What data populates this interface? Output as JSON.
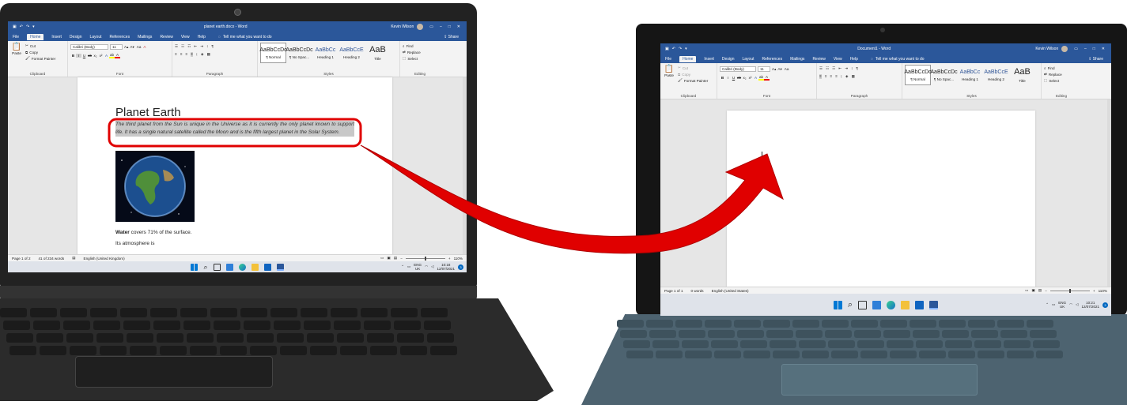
{
  "left_window": {
    "title": "planet earth.docx - Word",
    "user": "Kevin Wilson",
    "tabs": [
      "File",
      "Home",
      "Insert",
      "Design",
      "Layout",
      "References",
      "Mailings",
      "Review",
      "View",
      "Help"
    ],
    "tell_me": "Tell me what you want to do",
    "share": "Share",
    "clipboard": {
      "paste": "Paste",
      "cut": "Cut",
      "copy": "Copy",
      "format_painter": "Format Painter",
      "label": "Clipboard"
    },
    "font": {
      "name": "Calibri (Body)",
      "size": "11",
      "label": "Font"
    },
    "paragraph_label": "Paragraph",
    "styles": [
      {
        "preview": "AaBbCcDc",
        "name": "¶ Normal"
      },
      {
        "preview": "AaBbCcDc",
        "name": "¶ No Spac..."
      },
      {
        "preview": "AaBbCc",
        "name": "Heading 1"
      },
      {
        "preview": "AaBbCcE",
        "name": "Heading 2"
      },
      {
        "preview": "AaB",
        "name": "Title"
      }
    ],
    "styles_label": "Styles",
    "editing": {
      "find": "Find",
      "replace": "Replace",
      "select": "Select",
      "label": "Editing"
    },
    "document": {
      "heading": "Planet Earth",
      "paragraph": "The third planet from the Sun is unique in the Universe as it is currently the only planet known to support life. It has a single natural satellite called the Moon and is the fifth largest planet in the Solar System.",
      "water_bold": "Water",
      "water_rest": " covers 71% of the surface.",
      "atmosphere": "Its atmosphere is"
    },
    "status": {
      "page": "Page 1 of 2",
      "words": "41 of 234 words",
      "language": "English (United Kingdom)",
      "zoom": "110%"
    },
    "tray": {
      "lang": "ENG",
      "region": "UK",
      "time": "10:18",
      "date": "12/07/2021",
      "notifications": "3"
    }
  },
  "right_window": {
    "title": "Document1 - Word",
    "user": "Kevin Wilson",
    "tabs": [
      "File",
      "Home",
      "Insert",
      "Design",
      "Layout",
      "References",
      "Mailings",
      "Review",
      "View",
      "Help"
    ],
    "tell_me": "Tell me what you want to do",
    "share": "Share",
    "clipboard": {
      "paste": "Paste",
      "cut": "Cut",
      "copy": "Copy",
      "format_painter": "Format Painter",
      "label": "Clipboard"
    },
    "font": {
      "name": "Calibri (Body)",
      "size": "11",
      "label": "Font"
    },
    "paragraph_label": "Paragraph",
    "styles": [
      {
        "preview": "AaBbCcDc",
        "name": "¶ Normal"
      },
      {
        "preview": "AaBbCcDc",
        "name": "¶ No Spac..."
      },
      {
        "preview": "AaBbCc",
        "name": "Heading 1"
      },
      {
        "preview": "AaBbCcE",
        "name": "Heading 2"
      },
      {
        "preview": "AaB",
        "name": "Title"
      }
    ],
    "styles_label": "Styles",
    "editing": {
      "find": "Find",
      "replace": "Replace",
      "select": "Select",
      "label": "Editing"
    },
    "status": {
      "page": "Page 1 of 1",
      "words": "0 words",
      "language": "English (United States)",
      "zoom": "110%"
    },
    "tray": {
      "lang": "ENG",
      "region": "UK",
      "time": "10:21",
      "date": "12/07/2021",
      "notifications": "3"
    }
  },
  "colors": {
    "word_blue": "#2b579a",
    "highlight_red": "#e00000",
    "laptop_left": "#2a2a2a",
    "laptop_right": "#1c1c1c",
    "keyboard_right": "#4d6370"
  }
}
